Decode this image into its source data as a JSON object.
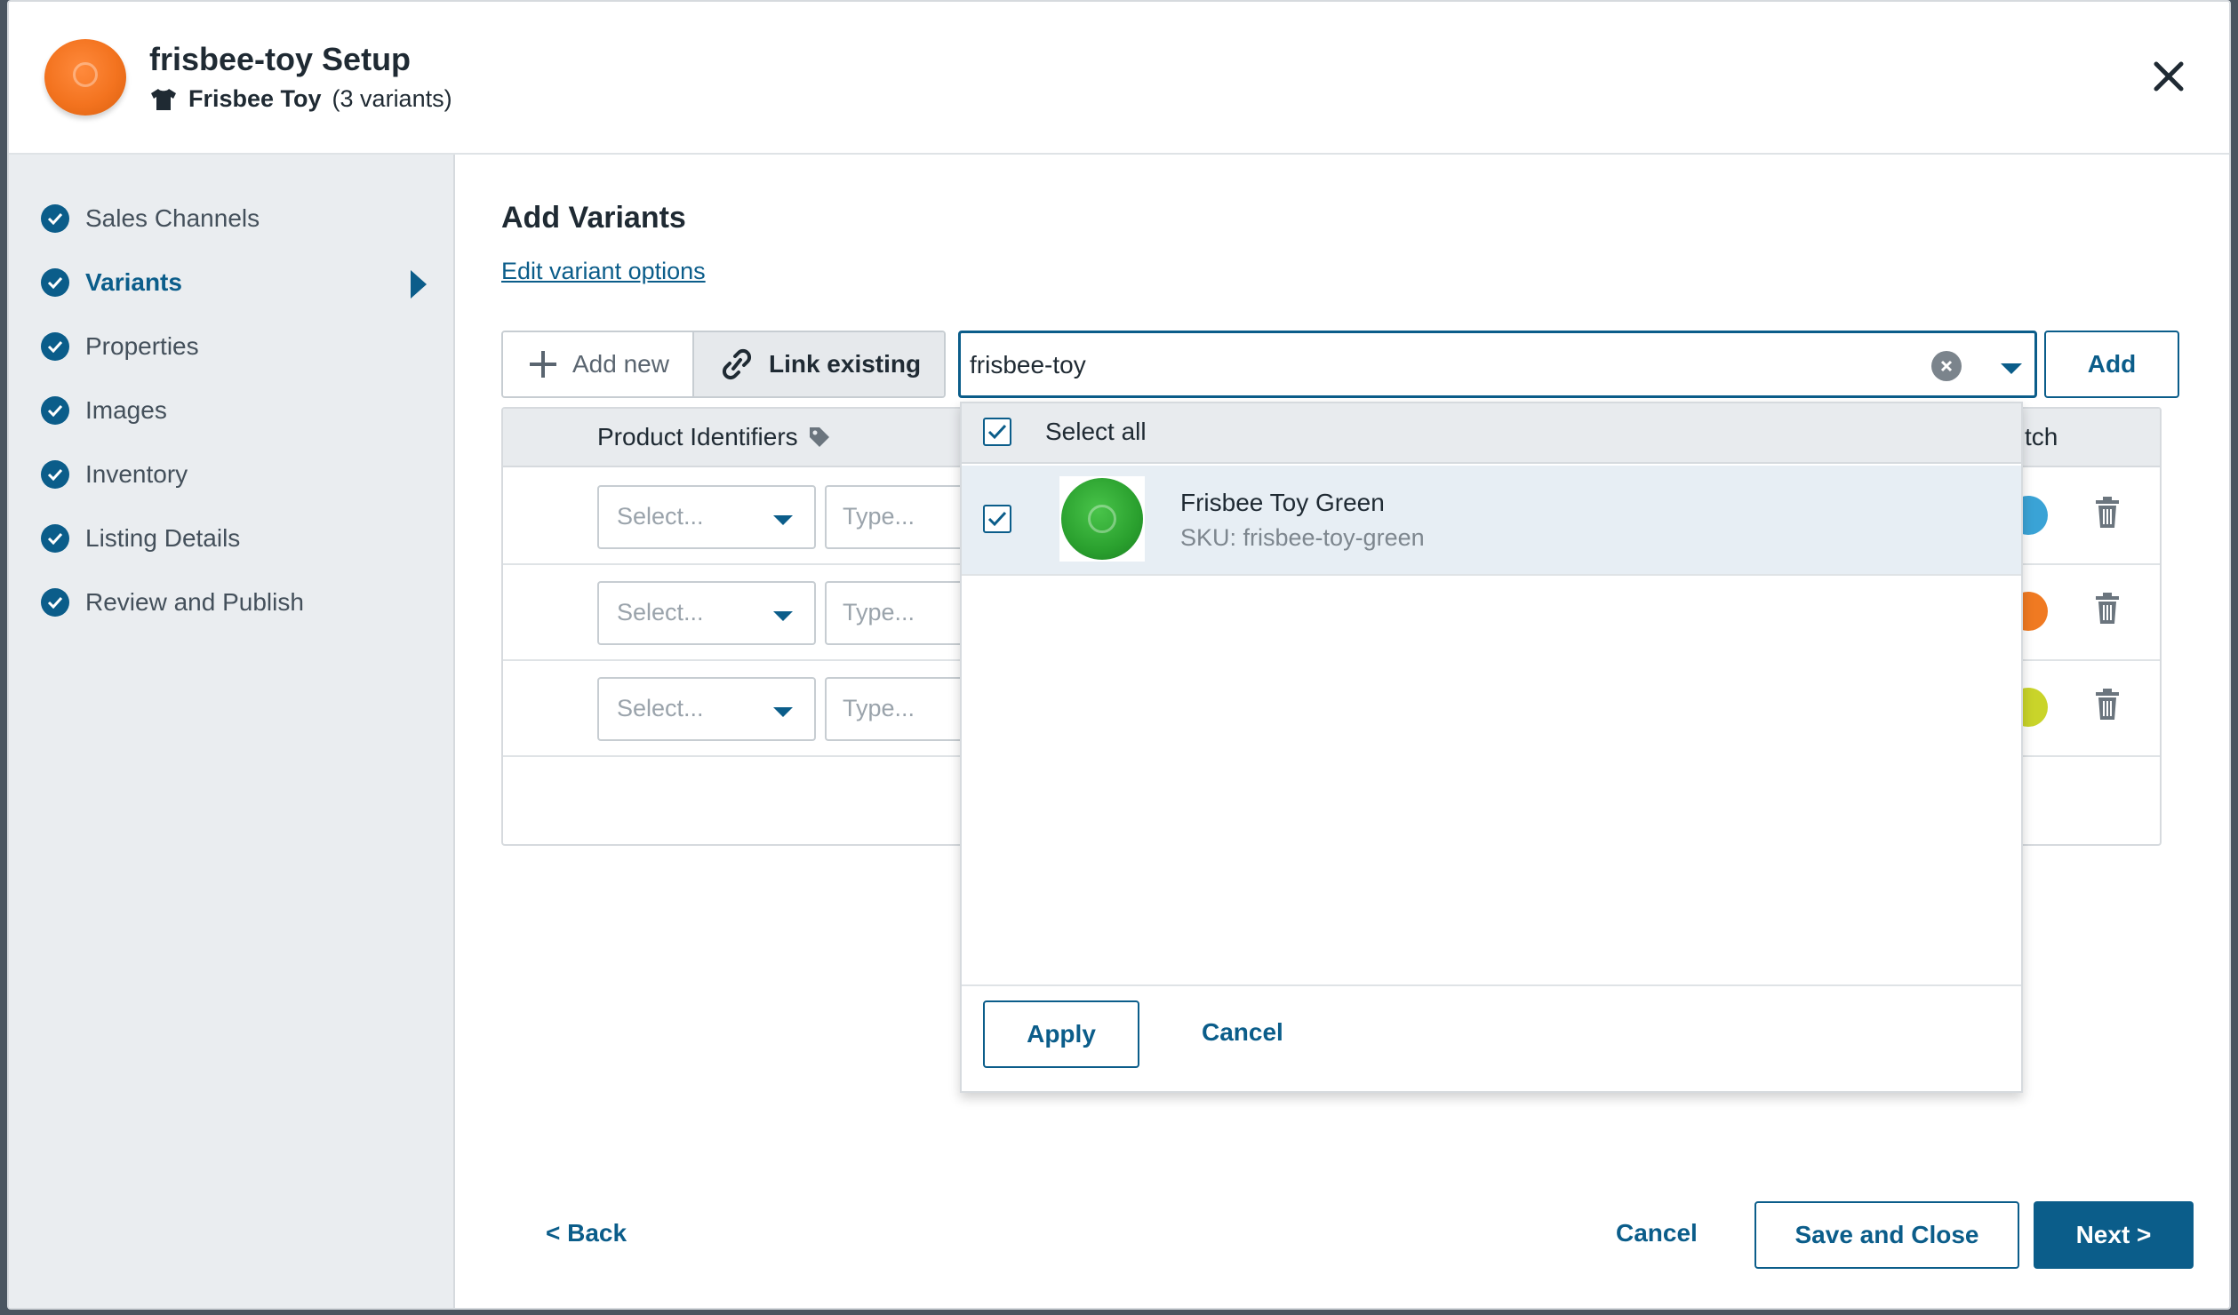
{
  "header": {
    "title": "frisbee-toy Setup",
    "product_name": "Frisbee Toy",
    "variant_count": "(3 variants)"
  },
  "sidebar": {
    "items": [
      {
        "label": "Sales Channels"
      },
      {
        "label": "Variants"
      },
      {
        "label": "Properties"
      },
      {
        "label": "Images"
      },
      {
        "label": "Inventory"
      },
      {
        "label": "Listing Details"
      },
      {
        "label": "Review and Publish"
      }
    ]
  },
  "main": {
    "title": "Add Variants",
    "edit_link": "Edit variant options",
    "add_new_label": "Add new",
    "link_existing_label": "Link existing",
    "search_value": "frisbee-toy",
    "add_label": "Add"
  },
  "table": {
    "col_identifiers": "Product Identifiers",
    "col_match": "tch",
    "select_placeholder": "Select...",
    "type_placeholder": "Type...",
    "row_swatches": [
      "#3aa3d6",
      "#f07a22",
      "#c9d42a"
    ]
  },
  "dropdown": {
    "select_all": "Select all",
    "item_name": "Frisbee Toy Green",
    "item_sku": "SKU: frisbee-toy-green",
    "apply_label": "Apply",
    "cancel_label": "Cancel"
  },
  "footer": {
    "back_label": "< Back",
    "cancel_label": "Cancel",
    "save_close_label": "Save and Close",
    "next_label": "Next >"
  },
  "colors": {
    "accent": "#0b5d8a",
    "sidebar_bg": "#eaedf0"
  }
}
